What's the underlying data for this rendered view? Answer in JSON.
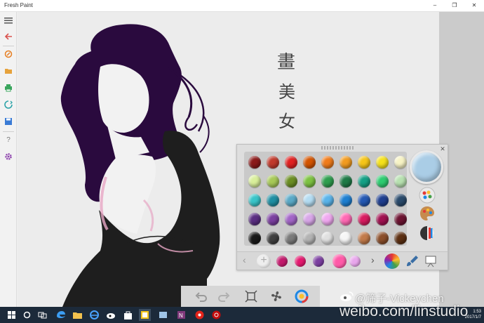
{
  "window": {
    "title": "Fresh Paint",
    "minimize": "–",
    "restore": "❐",
    "close": "✕"
  },
  "sidebar": {
    "items": [
      {
        "name": "menu-icon",
        "color": "#555555"
      },
      {
        "name": "back-icon",
        "color": "#d9534f"
      },
      {
        "name": "new-icon",
        "color": "#e67e22"
      },
      {
        "name": "open-icon",
        "color": "#e6a23c"
      },
      {
        "name": "print-icon",
        "color": "#3aa55d"
      },
      {
        "name": "share-icon",
        "color": "#2fa4a9"
      },
      {
        "name": "save-icon",
        "color": "#3a7bd5"
      },
      {
        "name": "help-icon",
        "color": "#777777"
      },
      {
        "name": "settings-icon",
        "color": "#8e44ad"
      }
    ],
    "help_glyph": "?"
  },
  "palette": {
    "close_glyph": "✕",
    "rows": [
      [
        "#8b1a1a",
        "#c0392b",
        "#e02121",
        "#d35400",
        "#f07b1a",
        "#f29b1f",
        "#f5c518",
        "#f5e11a",
        "#f7f3c4"
      ],
      [
        "#d9ef9a",
        "#a7c957",
        "#6b8e23",
        "#7dc242",
        "#2e9e4f",
        "#1e7a46",
        "#14a085",
        "#2ecc71",
        "#b7e1b0"
      ],
      [
        "#39c5c9",
        "#1f8fa3",
        "#5aa9c7",
        "#b3dcf2",
        "#5ab4ea",
        "#1e7fd1",
        "#2458b3",
        "#1f3f8f",
        "#2a4a6b"
      ],
      [
        "#5a2d82",
        "#7b3fa0",
        "#a265c7",
        "#d8a6e8",
        "#f0a8f0",
        "#ff69b4",
        "#d81b60",
        "#a01050",
        "#6d1432"
      ],
      [
        "#1a1a1a",
        "#404040",
        "#7a7a7a",
        "#b3b3b3",
        "#e0e0e0",
        "#f6f6f6",
        "#c27a4a",
        "#8b4e2a",
        "#5c2f12"
      ]
    ],
    "current_color": "#aacde6",
    "mix_colors": [
      "#e8e8e8",
      "#c2186b",
      "#e3186e",
      "#7b3fa0",
      "#ff5aa8",
      "#e8a6ec"
    ],
    "prev_glyph": "‹",
    "next_glyph": "›",
    "tools": [
      "color-mixer-icon",
      "palette-icon",
      "paint-swatch-icon",
      "brush-icon",
      "easel-icon"
    ]
  },
  "drawing": {
    "hair_color": "#2a0a3e",
    "body_color": "#1e1e1e",
    "skin_color": "#f2f2f2",
    "blush_color": "#e7a6c4",
    "calligraphy": [
      "畫",
      "美",
      "女"
    ]
  },
  "canvas_toolbar": [
    "undo-icon",
    "redo-icon",
    "fit-screen-icon",
    "fan-icon",
    "color-wheel-icon"
  ],
  "taskbar": {
    "apps": [
      "start-icon",
      "cortana-icon",
      "task-view-icon",
      "edge-icon",
      "file-explorer-icon",
      "ie-icon",
      "weibo-icon",
      "store-icon",
      "fresh-paint-icon",
      "ink-icon",
      "onenote-icon",
      "music-icon",
      "netease-icon"
    ],
    "time": "1:53",
    "date": "2017/1/7"
  },
  "watermark": {
    "handle": "@筛子-Vickeychen",
    "url": "weibo.com/linstudio"
  }
}
